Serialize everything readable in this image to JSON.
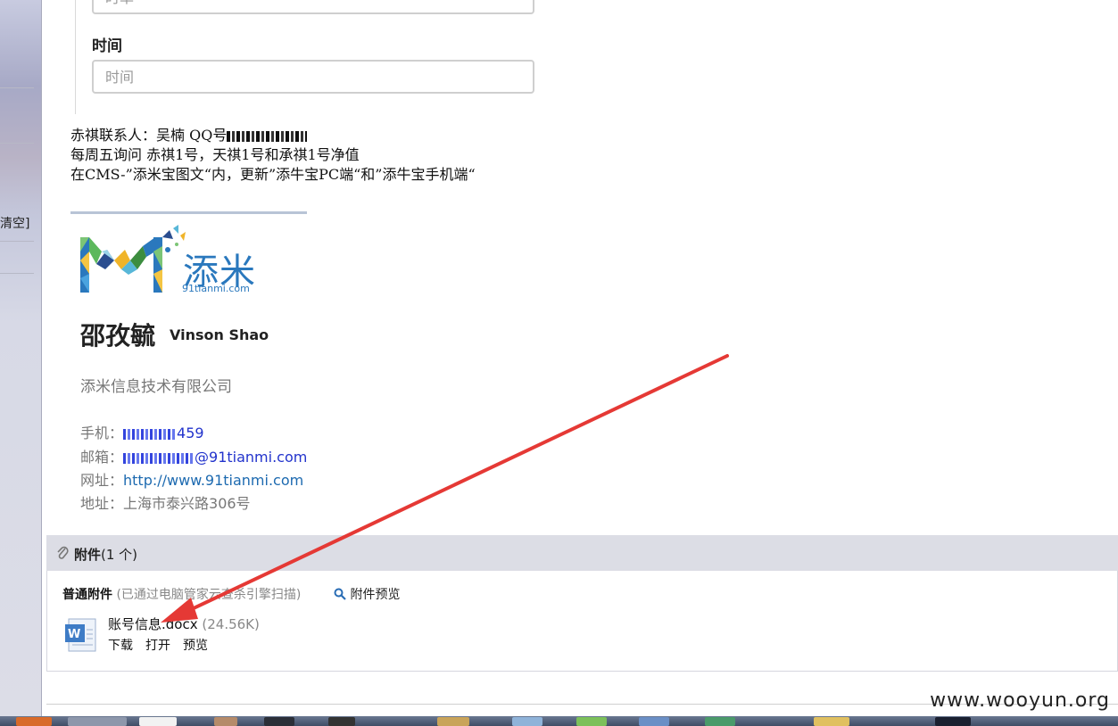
{
  "sidebar": {
    "clear_label": "清空]"
  },
  "form": {
    "prev_placeholder": "时单",
    "time_label": "时间",
    "time_placeholder": "时间"
  },
  "notes": {
    "line1_prefix": "赤祺联系人：吴楠 QQ号",
    "line2": "每周五询问 赤祺1号，天祺1号和承祺1号净值",
    "line3": "在CMS-”添米宝图文“内，更新”添牛宝PC端“和”添牛宝手机端“"
  },
  "signature": {
    "logo_text": "添米",
    "logo_domain": "91tianmi.com",
    "name_cn": "邵孜毓",
    "name_en": "Vinson Shao",
    "company": "添米信息技术有限公司",
    "phone_label": "手机：",
    "phone_suffix": "459",
    "email_label": "邮箱：",
    "email_suffix": "@91tianmi.com",
    "website_label": "网址：",
    "website": "http://www.91tianmi.com",
    "address_label": "地址：",
    "address": "上海市泰兴路306号"
  },
  "attachments": {
    "title_bold": "附件",
    "title_count": "(1 个)",
    "kind_label": "普通附件",
    "scan_note": "(已通过电脑管家云查杀引擎扫描)",
    "preview_all": "附件预览",
    "file": {
      "name": "账号信息.docx",
      "size": "(24.56K)",
      "actions": [
        "下载",
        "打开",
        "预览"
      ]
    }
  },
  "watermark": "www.wooyun.org",
  "colors": {
    "link": "#1d6ab0",
    "arrow": "#e53935",
    "panel_header": "#dcdde5"
  }
}
